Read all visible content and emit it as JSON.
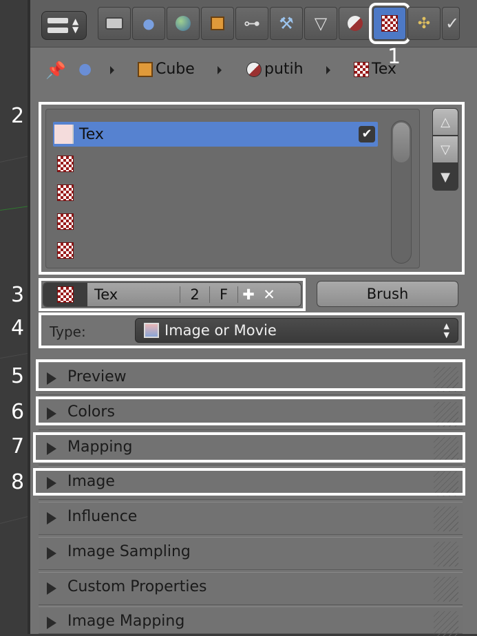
{
  "colors": {
    "accent": "#5682d0",
    "highlight": "#ffffff",
    "panel": "#737373"
  },
  "header": {
    "tabs": [
      "camera-icon",
      "scene-icon",
      "world-icon",
      "object-icon",
      "constraint-icon",
      "modifier-icon",
      "mesh-data-icon",
      "material-icon",
      "texture-icon",
      "particles-icon",
      "physics-icon"
    ],
    "active_tab": "texture-icon"
  },
  "breadcrumb": {
    "items": [
      {
        "label": "",
        "icon": "scene-icon"
      },
      {
        "label": "Cube",
        "icon": "cube-icon"
      },
      {
        "label": "putih",
        "icon": "material-icon"
      },
      {
        "label": "Tex",
        "icon": "texture-icon"
      }
    ]
  },
  "callouts": [
    "1",
    "2",
    "3",
    "4",
    "5",
    "6",
    "7",
    "8"
  ],
  "texture_slots": {
    "items": [
      {
        "label": "Tex",
        "selected": true,
        "enabled": true
      },
      {
        "label": "",
        "selected": false
      },
      {
        "label": "",
        "selected": false
      },
      {
        "label": "",
        "selected": false
      },
      {
        "label": "",
        "selected": false
      }
    ]
  },
  "datablock": {
    "name": "Tex",
    "users": "2",
    "fake": "F",
    "brush_label": "Brush"
  },
  "type": {
    "label": "Type:",
    "value": "Image or Movie"
  },
  "sections": [
    {
      "label": "Preview",
      "highlighted": true
    },
    {
      "label": "Colors",
      "highlighted": true
    },
    {
      "label": "Mapping",
      "highlighted": true
    },
    {
      "label": "Image",
      "highlighted": true
    },
    {
      "label": "Influence",
      "highlighted": false
    },
    {
      "label": "Image Sampling",
      "highlighted": false
    },
    {
      "label": "Custom Properties",
      "highlighted": false
    },
    {
      "label": "Image Mapping",
      "highlighted": false
    }
  ]
}
